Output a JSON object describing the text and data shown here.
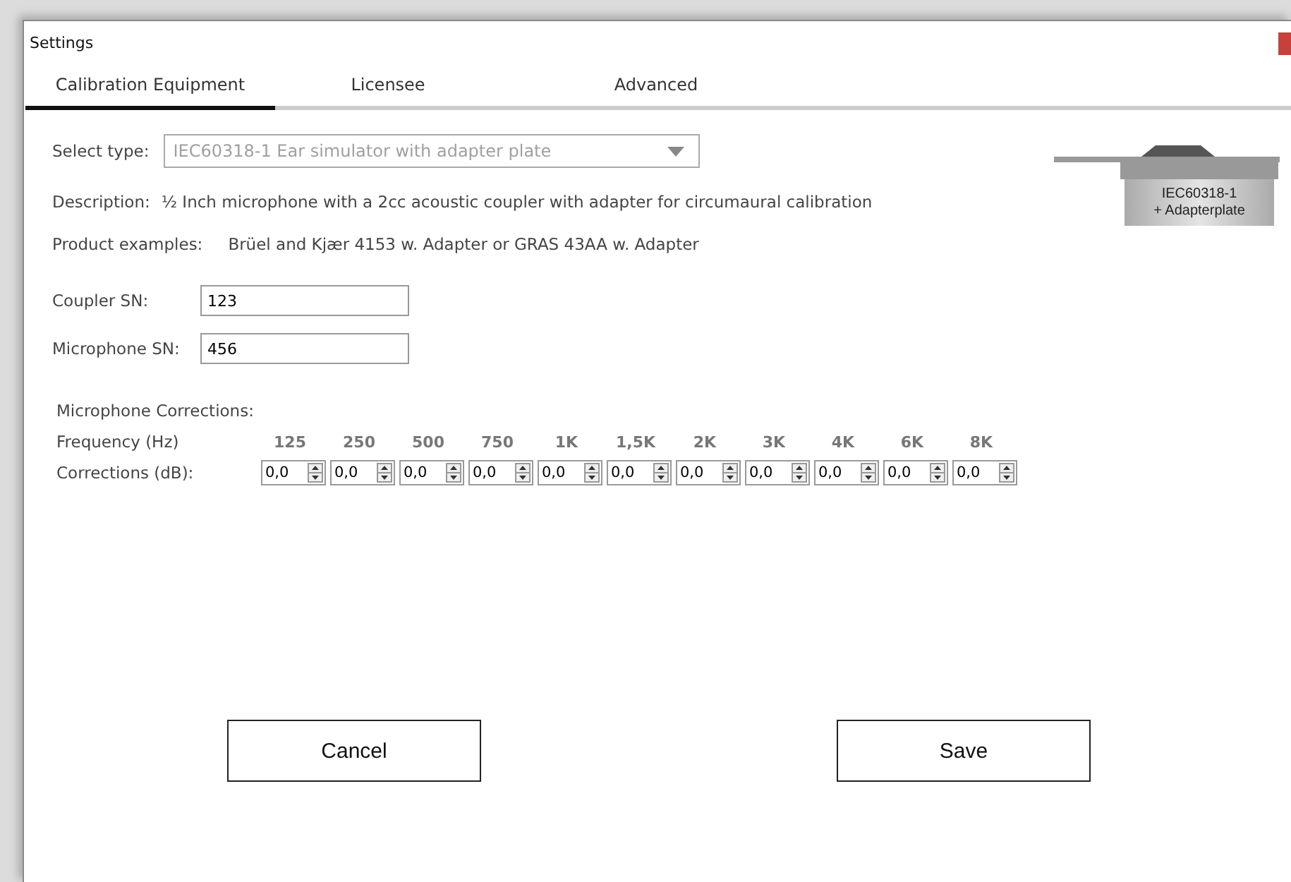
{
  "window": {
    "title": "Settings"
  },
  "tabs": [
    {
      "label": "Calibration Equipment",
      "selected": true
    },
    {
      "label": "Licensee",
      "selected": false
    },
    {
      "label": "Advanced",
      "selected": false
    }
  ],
  "select_type": {
    "label": "Select type:",
    "value": "IEC60318-1 Ear simulator with adapter plate",
    "disabled": true
  },
  "description": {
    "label": "Description:",
    "text": "½ Inch microphone with a 2cc acoustic coupler with adapter for circumaural calibration"
  },
  "product_examples": {
    "label": "Product examples:",
    "text": "Brüel and Kjær 4153 w. Adapter or GRAS 43AA w. Adapter"
  },
  "coupler_image": {
    "line_1": "IEC60318-1",
    "line_2": "+ Adapterplate"
  },
  "coupler_sn": {
    "label": "Coupler SN:",
    "value": "123"
  },
  "microphone_sn": {
    "label": "Microphone SN:",
    "value": "456"
  },
  "corrections": {
    "title": "Microphone Corrections:",
    "frequency_label": "Frequency (Hz)",
    "corrections_label": "Corrections (dB):",
    "columns": [
      {
        "frequency": "125",
        "value": "0,0"
      },
      {
        "frequency": "250",
        "value": "0,0"
      },
      {
        "frequency": "500",
        "value": "0,0"
      },
      {
        "frequency": "750",
        "value": "0,0"
      },
      {
        "frequency": "1K",
        "value": "0,0"
      },
      {
        "frequency": "1,5K",
        "value": "0,0"
      },
      {
        "frequency": "2K",
        "value": "0,0"
      },
      {
        "frequency": "3K",
        "value": "0,0"
      },
      {
        "frequency": "4K",
        "value": "0,0"
      },
      {
        "frequency": "6K",
        "value": "0,0"
      },
      {
        "frequency": "8K",
        "value": "0,0"
      }
    ]
  },
  "buttons": [
    {
      "label": "Cancel"
    },
    {
      "label": "Save"
    }
  ]
}
